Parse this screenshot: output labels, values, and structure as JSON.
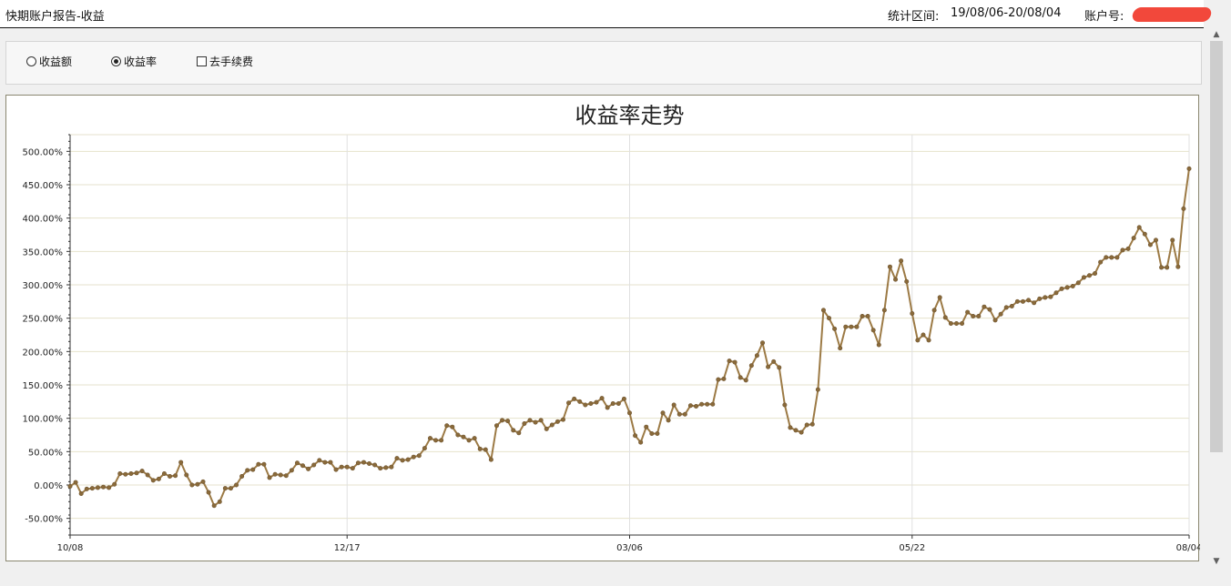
{
  "header": {
    "title": "快期账户报告-收益",
    "range_label": "统计区间:",
    "range_value": "19/08/06-20/08/04",
    "account_label": "账户号:"
  },
  "options": {
    "profit_amount": "收益额",
    "profit_rate": "收益率",
    "remove_fee": "去手续费",
    "selected": "收益率",
    "remove_fee_checked": false
  },
  "scrollbar": {
    "up_icon": "▲",
    "down_icon": "▼"
  },
  "colors": {
    "line": "#9c7a45",
    "marker": "#8a6a3a",
    "grid": "#e6e2cc",
    "vgrid": "#e0e0e0",
    "axis": "#333333",
    "redaction": "#f2483b"
  },
  "chart_data": {
    "type": "line",
    "title": "收益率走势",
    "ylim": [
      -75,
      525
    ],
    "y_ticks": [
      -50,
      0,
      50,
      100,
      150,
      200,
      250,
      300,
      350,
      400,
      450,
      500
    ],
    "y_tick_labels": [
      "-50.00%",
      "0.00%",
      "50.00%",
      "100.00%",
      "150.00%",
      "200.00%",
      "250.00%",
      "300.00%",
      "350.00%",
      "400.00%",
      "450.00%",
      "500.00%"
    ],
    "x_ticks": [
      {
        "index": 0,
        "label": "10/08"
      },
      {
        "index": 50,
        "label": "12/17"
      },
      {
        "index": 101,
        "label": "03/06"
      },
      {
        "index": 152,
        "label": "05/22"
      },
      {
        "index": 202,
        "label": "08/04"
      }
    ],
    "x_count": 203,
    "grid": true,
    "legend": "none",
    "series": [
      {
        "values": [
          -2,
          4,
          -13,
          -6,
          -5,
          -4,
          -3,
          -4,
          1,
          17,
          16,
          17,
          18,
          21,
          15,
          7,
          9,
          17,
          13,
          14,
          34,
          15,
          0,
          1,
          5,
          -11,
          -31,
          -25,
          -5,
          -5,
          0,
          13,
          22,
          23,
          31,
          31,
          11,
          16,
          15,
          14,
          22,
          33,
          29,
          24,
          30,
          37,
          34,
          34,
          23,
          27,
          27,
          25,
          33,
          34,
          32,
          30,
          25,
          26,
          27,
          40,
          37,
          38,
          42,
          44,
          55,
          70,
          67,
          67,
          89,
          87,
          75,
          72,
          67,
          70,
          54,
          53,
          38,
          89,
          97,
          96,
          82,
          78,
          92,
          97,
          94,
          97,
          84,
          90,
          95,
          98,
          123,
          129,
          125,
          120,
          122,
          124,
          130,
          116,
          122,
          122,
          129,
          108,
          74,
          64,
          87,
          77,
          77,
          108,
          97,
          120,
          106,
          106,
          119,
          118,
          121,
          121,
          121,
          158,
          159,
          186,
          184,
          161,
          157,
          179,
          194,
          213,
          177,
          185,
          176,
          120,
          86,
          82,
          79,
          90,
          91,
          143,
          262,
          250,
          234,
          205,
          237,
          237,
          237,
          253,
          253,
          232,
          210,
          262,
          327,
          308,
          336,
          305,
          257,
          217,
          225,
          217,
          262,
          281,
          251,
          242,
          242,
          242,
          259,
          253,
          253,
          267,
          263,
          247,
          256,
          266,
          268,
          275,
          275,
          277,
          273,
          279,
          281,
          282,
          288,
          294,
          296,
          298,
          303,
          311,
          314,
          317,
          334,
          341,
          341,
          341,
          352,
          354,
          370,
          386,
          376,
          360,
          367,
          326,
          326,
          367,
          327,
          414,
          474
        ]
      }
    ]
  }
}
